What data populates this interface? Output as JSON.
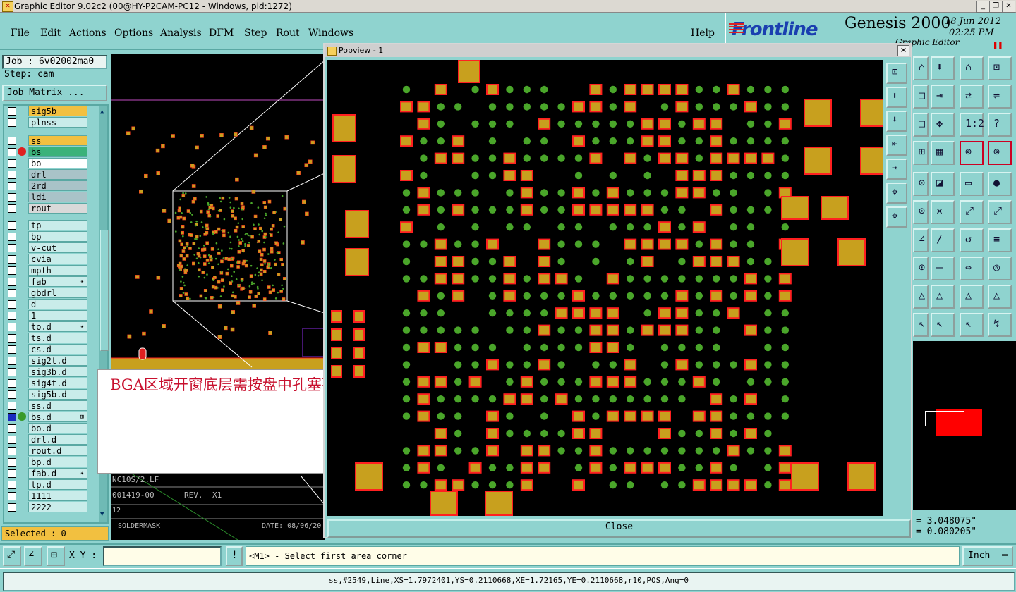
{
  "window": {
    "title": "Graphic Editor 9.02c2 (00@HY-P2CAM-PC12 - Windows, pid:1272)"
  },
  "menu": [
    "File",
    "Edit",
    "Actions",
    "Options",
    "Analysis",
    "DFM",
    "Step",
    "Rout",
    "Windows",
    "Help"
  ],
  "brand": {
    "logo": "Frontline",
    "product": "Genesis 2000",
    "date": "18 Jun 2012",
    "time": "02:25 PM",
    "subtitle": "Graphic Editor"
  },
  "job": {
    "job_label": "Job : 6v02002ma0",
    "step_label": "Step: cam",
    "matrix_button": "Job Matrix ..."
  },
  "layers": [
    {
      "name": "sig5b",
      "color": "#f2c040",
      "dot": ""
    },
    {
      "name": "plnss",
      "color": "#c9ecea",
      "dot": ""
    },
    {
      "name": "ss",
      "color": "#f2c040",
      "dot": ""
    },
    {
      "name": "bs",
      "color": "#3bb27a",
      "dot": "#e02020"
    },
    {
      "name": "bo",
      "color": "#ffffff",
      "dot": ""
    },
    {
      "name": "drl",
      "color": "#a9c3c8",
      "dot": ""
    },
    {
      "name": "2rd",
      "color": "#a9c3c8",
      "dot": ""
    },
    {
      "name": "ldi",
      "color": "#a9c3c8",
      "dot": ""
    },
    {
      "name": "rout",
      "color": "#d9d9d9",
      "dot": ""
    },
    {
      "name": "tp",
      "color": "#c9ecea",
      "dot": ""
    },
    {
      "name": "bp",
      "color": "#c9ecea",
      "dot": ""
    },
    {
      "name": "v-cut",
      "color": "#c9ecea",
      "dot": ""
    },
    {
      "name": "cvia",
      "color": "#c9ecea",
      "dot": ""
    },
    {
      "name": "mpth",
      "color": "#c9ecea",
      "dot": ""
    },
    {
      "name": "fab",
      "color": "#c9ecea",
      "dot": "",
      "extra": "✴"
    },
    {
      "name": "gbdrl",
      "color": "#c9ecea",
      "dot": ""
    },
    {
      "name": "d",
      "color": "#c9ecea",
      "dot": ""
    },
    {
      "name": "1",
      "color": "#c9ecea",
      "dot": ""
    },
    {
      "name": "to.d",
      "color": "#c9ecea",
      "dot": "",
      "extra": "✴"
    },
    {
      "name": "ts.d",
      "color": "#c9ecea",
      "dot": ""
    },
    {
      "name": "cs.d",
      "color": "#c9ecea",
      "dot": ""
    },
    {
      "name": "sig2t.d",
      "color": "#c9ecea",
      "dot": ""
    },
    {
      "name": "sig3b.d",
      "color": "#c9ecea",
      "dot": ""
    },
    {
      "name": "sig4t.d",
      "color": "#c9ecea",
      "dot": ""
    },
    {
      "name": "sig5b.d",
      "color": "#c9ecea",
      "dot": ""
    },
    {
      "name": "ss.d",
      "color": "#c9ecea",
      "dot": ""
    },
    {
      "name": "bs.d",
      "color": "#c9ecea",
      "dot": "#3a9a2a",
      "extra": "⊞"
    },
    {
      "name": "bo.d",
      "color": "#c9ecea",
      "dot": ""
    },
    {
      "name": "drl.d",
      "color": "#c9ecea",
      "dot": ""
    },
    {
      "name": "rout.d",
      "color": "#c9ecea",
      "dot": ""
    },
    {
      "name": "bp.d",
      "color": "#c9ecea",
      "dot": ""
    },
    {
      "name": "fab.d",
      "color": "#c9ecea",
      "dot": "",
      "extra": "✴"
    },
    {
      "name": "tp.d",
      "color": "#c9ecea",
      "dot": ""
    },
    {
      "name": "1111",
      "color": "#c9ecea",
      "dot": ""
    },
    {
      "name": "2222",
      "color": "#c9ecea",
      "dot": ""
    }
  ],
  "selected_label": "Selected : 0",
  "canvas_text": {
    "line1": "NC10S/2.LF",
    "line2": "001419-00",
    "rev": "REV.",
    "rev_val": "X1",
    "num": "12",
    "mask": "SOLDERMASK",
    "date": "DATE: 08/06/20"
  },
  "note": "BGA区域开窗底层需按盘中孔塞孔制作",
  "popview": {
    "title": "Popview - 1",
    "close_label": "Close"
  },
  "coords": {
    "x": "= 3.048075\"",
    "y": "= 0.080205\""
  },
  "cmd": {
    "xy_label": "X Y :",
    "xy_value": "",
    "prompt": "<M1> - Select first area corner",
    "units": "Inch"
  },
  "status": "ss,#2549,Line,XS=1.7972401,YS=0.2110668,XE=1.72165,YE=0.2110668,r10,POS,Ang=0",
  "colors": {
    "pad": "#c8a01e",
    "pad_border": "#ff2020",
    "via": "#4aa62a",
    "panel": "#8fd3cf"
  }
}
